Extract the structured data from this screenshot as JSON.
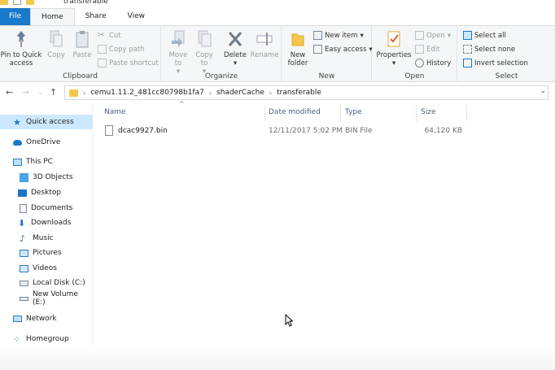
{
  "window": {
    "title": "transferable"
  },
  "tabs": [
    {
      "label": "File"
    },
    {
      "label": "Home"
    },
    {
      "label": "Share"
    },
    {
      "label": "View"
    }
  ],
  "ribbon": {
    "clipboard": {
      "label": "Clipboard",
      "pin": "Pin to Quick access",
      "copy": "Copy",
      "paste": "Paste",
      "cut": "Cut",
      "copy_path": "Copy path",
      "paste_shortcut": "Paste shortcut"
    },
    "organize": {
      "label": "Organize",
      "move_to": "Move to",
      "copy_to": "Copy to",
      "delete": "Delete",
      "rename": "Rename"
    },
    "new": {
      "label": "New",
      "new_folder": "New folder",
      "new_item": "New item",
      "easy_access": "Easy access"
    },
    "open": {
      "label": "Open",
      "properties": "Properties",
      "open": "Open",
      "edit": "Edit",
      "history": "History"
    },
    "select": {
      "label": "Select",
      "select_all": "Select all",
      "select_none": "Select none",
      "invert_selection": "Invert selection"
    }
  },
  "address": {
    "crumbs": [
      "cemu1.11.2_481cc80798b1fa7",
      "shaderCache",
      "transferable"
    ]
  },
  "nav": [
    {
      "label": "Quick access",
      "icon": "star-icon",
      "selected": true
    },
    {
      "label": "OneDrive",
      "icon": "cloud-icon"
    },
    {
      "label": "This PC",
      "icon": "computer-icon"
    },
    {
      "label": "3D Objects",
      "icon": "cube-icon"
    },
    {
      "label": "Desktop",
      "icon": "desktop-icon"
    },
    {
      "label": "Documents",
      "icon": "document-icon"
    },
    {
      "label": "Downloads",
      "icon": "download-icon"
    },
    {
      "label": "Music",
      "icon": "music-icon"
    },
    {
      "label": "Pictures",
      "icon": "picture-icon"
    },
    {
      "label": "Videos",
      "icon": "video-icon"
    },
    {
      "label": "Local Disk (C:)",
      "icon": "disk-icon"
    },
    {
      "label": "New Volume (E:)",
      "icon": "drive-icon"
    },
    {
      "label": "Network",
      "icon": "network-icon"
    },
    {
      "label": "Homegroup",
      "icon": "homegroup-icon"
    }
  ],
  "columns": {
    "name": "Name",
    "date": "Date modified",
    "type": "Type",
    "size": "Size"
  },
  "files": [
    {
      "name": "dcac9927.bin",
      "date": "12/11/2017 5:02 PM",
      "type": "BIN File",
      "size": "64,120 KB"
    }
  ],
  "colors": {
    "accent": "#1979ca",
    "selected": "#cce8ff",
    "folder": "#f2c84b"
  }
}
